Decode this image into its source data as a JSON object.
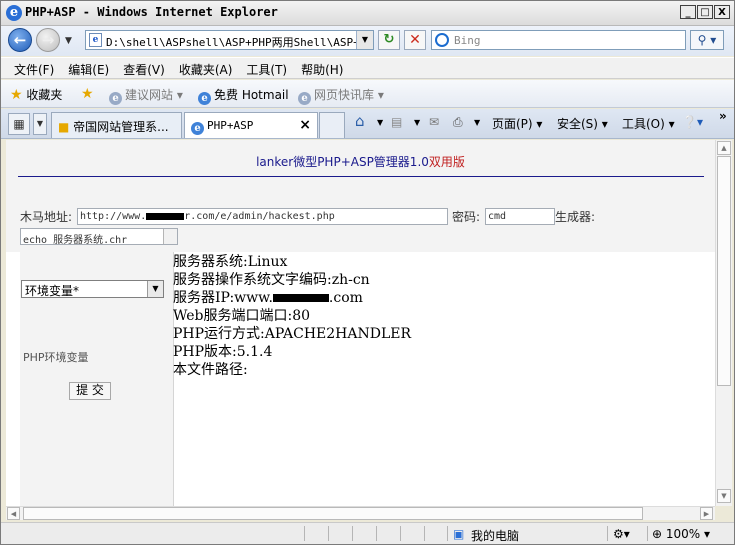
{
  "window": {
    "title": "PHP+ASP - Windows Internet Explorer",
    "controls": {
      "minimize": "_",
      "maximize": "□",
      "close": "X"
    }
  },
  "address": {
    "url": "D:\\shell\\ASPshell\\ASP+PHP两用Shell\\ASP+PH",
    "search_placeholder": "Bing"
  },
  "menu": [
    "文件(F)",
    "编辑(E)",
    "查看(V)",
    "收藏夹(A)",
    "工具(T)",
    "帮助(H)"
  ],
  "favorites": {
    "label": "收藏夹",
    "items": [
      {
        "label": "建议网站 ▾",
        "active": false
      },
      {
        "label": "免费 Hotmail",
        "active": true
      },
      {
        "label": "网页快讯库 ▾",
        "active": false
      }
    ]
  },
  "tabs": [
    {
      "label": "帝国网站管理系...",
      "active": false
    },
    {
      "label": "PHP+ASP",
      "active": true
    }
  ],
  "commands": {
    "page": "页面(P) ▾",
    "safety": "安全(S) ▾",
    "tools": "工具(O) ▾",
    "more": "»"
  },
  "page": {
    "headline_main": "lanker微型PHP+ASP管理器1.0",
    "headline_red": "双用版",
    "trojan_label": "木马地址:",
    "trojan_value_prefix": "http://www.",
    "trojan_value_suffix": "r.com/e/admin/hackest.php",
    "password_label": "密码:",
    "password_value": "cmd",
    "generator_label": "生成器:",
    "command_value": "echo 服务器系统.chr",
    "select_value": "环境变量*",
    "env_label": "PHP环境变量",
    "submit_label": "提 交",
    "output": {
      "os": "服务器系统:Linux",
      "encoding": "服务器操作系统文字编码:zh-cn",
      "ip_prefix": "服务器IP:www.",
      "ip_suffix": ".com",
      "port": "Web服务端口端口:80",
      "run_mode": "PHP运行方式:APACHE2HANDLER",
      "php_version": "PHP版本:5.1.4",
      "file_path": "本文件路径:"
    }
  },
  "status": {
    "zone": "我的电脑",
    "zoom": "100%"
  }
}
